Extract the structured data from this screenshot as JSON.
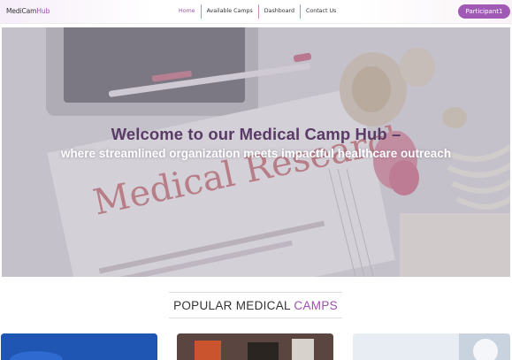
{
  "header": {
    "brand_main": "MediCam",
    "brand_accent": "Hub",
    "nav": [
      {
        "label": "Home",
        "active": true
      },
      {
        "label": "Available Camps",
        "active": false
      },
      {
        "label": "Dashboard",
        "active": false
      },
      {
        "label": "Contact Us",
        "active": false
      }
    ],
    "profile_label": "Participant1"
  },
  "hero": {
    "title": "Welcome to our Medical Camp Hub –",
    "subtitle": "where streamlined organization meets impactful healthcare outreach",
    "background_lettering": "Medical Research"
  },
  "section": {
    "title_main": "POPULAR MEDICAL",
    "title_accent": "CAMPS"
  },
  "colors": {
    "accent": "#9b4fb0",
    "hero_title": "#5a3a66",
    "profile_button": "#a05ab5"
  }
}
